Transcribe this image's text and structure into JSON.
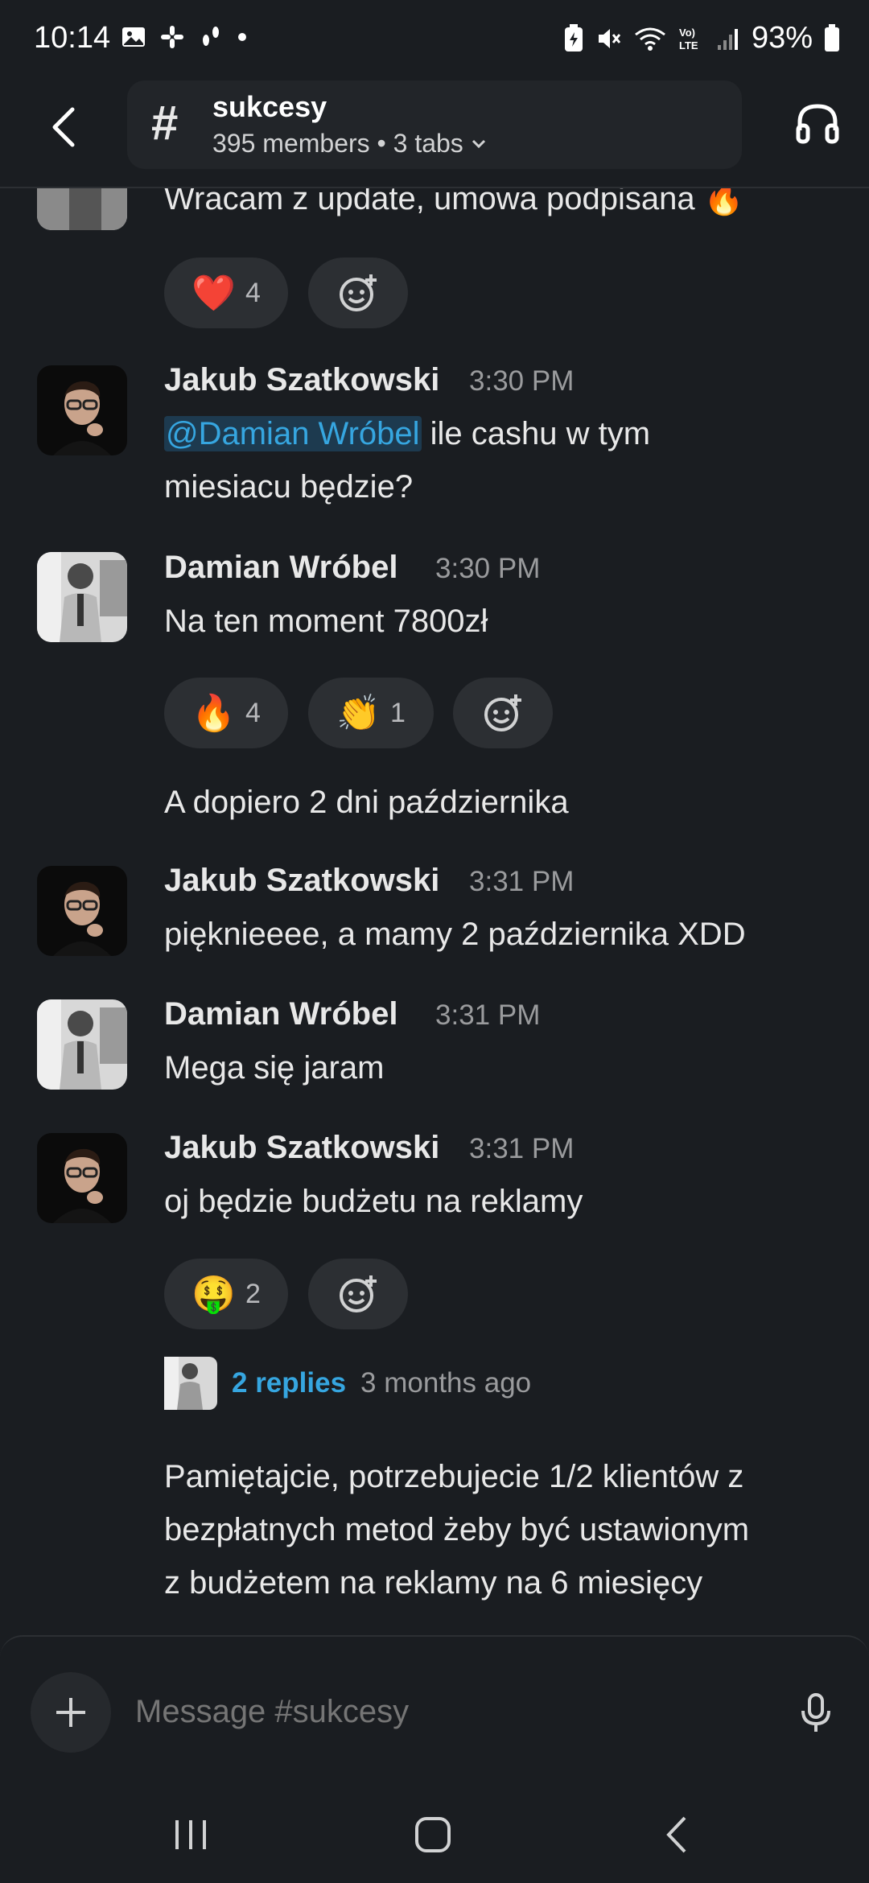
{
  "status_bar": {
    "time": "10:14",
    "battery": "93%"
  },
  "header": {
    "channel_name": "sukcesy",
    "channel_subtitle": "395 members • 3 tabs"
  },
  "messages": [
    {
      "text": "Wracam z update, umowa podpisana 🔥",
      "reactions": [
        {
          "emoji": "❤️",
          "count": "4"
        }
      ]
    },
    {
      "author": "Jakub Szatkowski",
      "time": "3:30 PM",
      "mention": "@Damian Wróbel",
      "text_line1": " ile cashu w tym",
      "text_line2": "miesiacu będzie?"
    },
    {
      "author": "Damian Wróbel",
      "time": "3:30 PM",
      "text": "Na ten moment 7800zł",
      "reactions": [
        {
          "emoji": "🔥",
          "count": "4"
        },
        {
          "emoji": "👏",
          "count": "1"
        }
      ],
      "followup": "A dopiero 2 dni października"
    },
    {
      "author": "Jakub Szatkowski",
      "time": "3:31 PM",
      "text": "pięknieeee, a mamy 2 października XDD"
    },
    {
      "author": "Damian Wróbel",
      "time": "3:31 PM",
      "text": "Mega się jaram"
    },
    {
      "author": "Jakub Szatkowski",
      "time": "3:31 PM",
      "text": "oj będzie budżetu na reklamy",
      "reactions": [
        {
          "emoji": "🤑",
          "count": "2"
        }
      ],
      "thread": {
        "replies": "2 replies",
        "ago": "3 months ago"
      },
      "followup_lines": [
        "Pamiętajcie, potrzebujecie 1/2 klientów z",
        "bezpłatnych metod żeby być ustawionym",
        "z budżetem na reklamy na 6 miesięcy"
      ]
    }
  ],
  "composer": {
    "placeholder": "Message #sukcesy"
  },
  "colors": {
    "background": "#1a1d21",
    "pill": "#2c2f33",
    "link": "#36a6e0"
  }
}
